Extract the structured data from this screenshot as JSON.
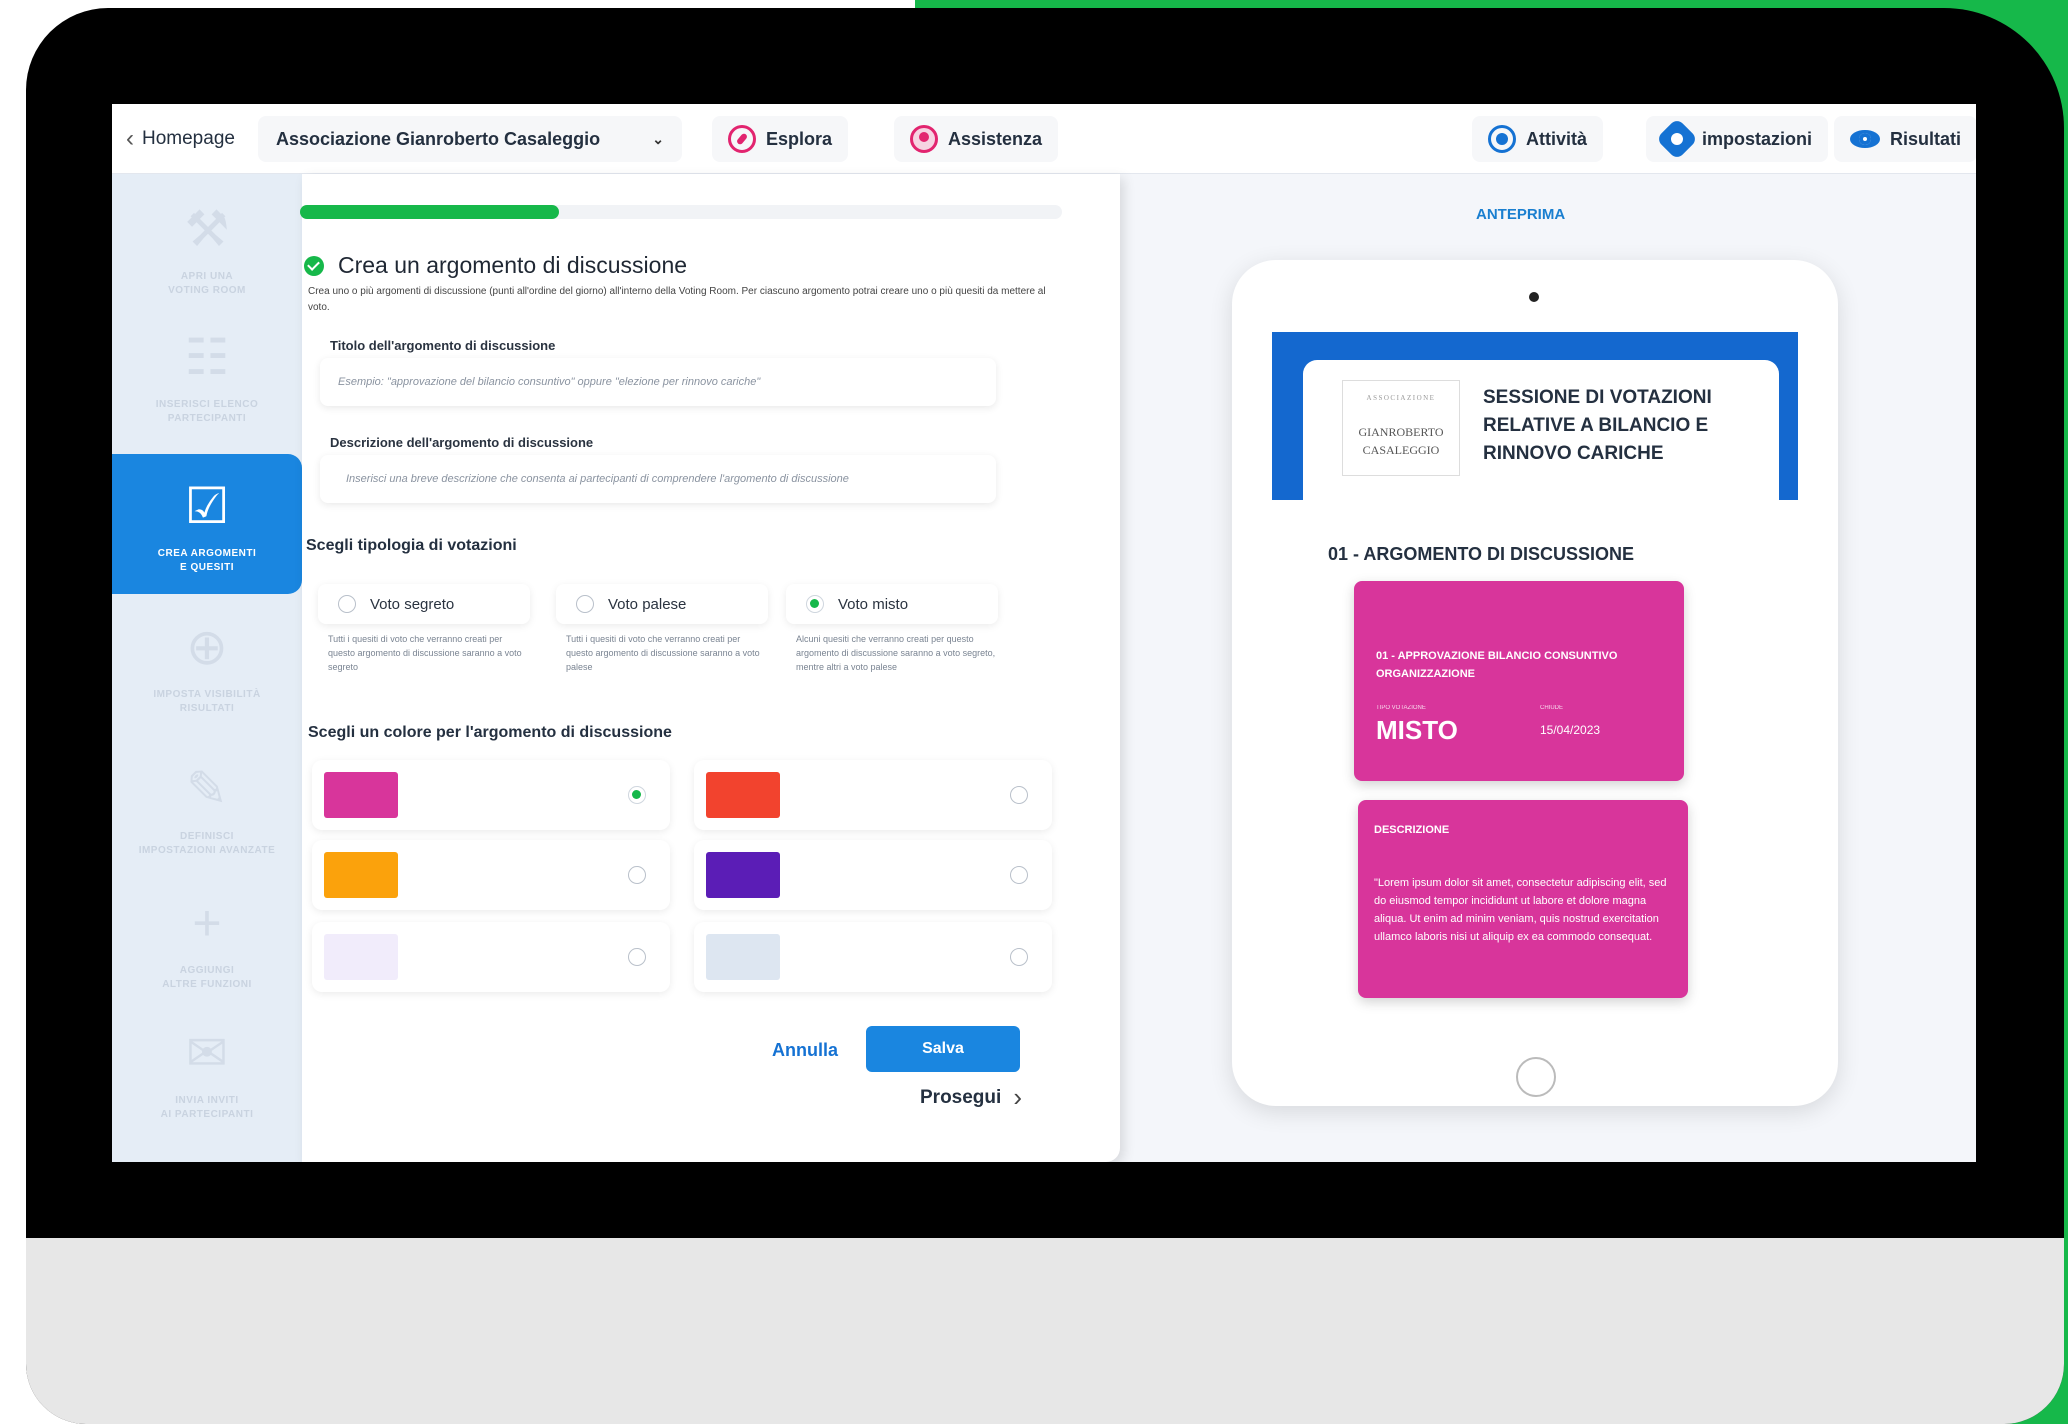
{
  "topbar": {
    "home_label": "Homepage",
    "org_label": "Associazione Gianroberto Casaleggio",
    "explore_label": "Esplora",
    "support_label": "Assistenza",
    "activity_label": "Attività",
    "settings_label": "impostazioni",
    "results_label": "Risultati"
  },
  "sidebar": {
    "items": [
      {
        "label": "APRI UNA\nVOTING ROOM",
        "icon": "compass-tools-icon"
      },
      {
        "label": "INSERISCI ELENCO\nPARTECIPANTI",
        "icon": "users-icon"
      },
      {
        "label": "CREA ARGOMENTI\nE QUESITI",
        "icon": "checkbox-icon",
        "active": true
      },
      {
        "label": "IMPOSTA VISIBILITÀ\nRISULTATI",
        "icon": "chart-search-icon"
      },
      {
        "label": "DEFINISCI\nIMPOSTAZIONI AVANZATE",
        "icon": "edit-icon"
      },
      {
        "label": "AGGIUNGI\nALTRE FUNZIONI",
        "icon": "plus-icon"
      },
      {
        "label": "INVIA INVITI\nAI PARTECIPANTI",
        "icon": "mail-icon"
      }
    ]
  },
  "form": {
    "progress_fraction": 0.34,
    "title": "Crea un argomento di discussione",
    "description": "Crea uno o più argomenti di discussione (punti all'ordine del giorno) all'interno della Voting Room. Per ciascuno argomento potrai creare uno o più quesiti da mettere al voto.",
    "topic_title_label": "Titolo dell'argomento di discussione",
    "topic_title_placeholder": "Esempio: \"approvazione del bilancio consuntivo\" oppure \"elezione per rinnovo cariche\"",
    "topic_desc_label": "Descrizione dell'argomento di discussione",
    "topic_desc_placeholder": "Inserisci una breve descrizione che consenta ai partecipanti di comprendere l'argomento di discussione",
    "vote_type_heading": "Scegli tipologia di votazioni",
    "vote_types": [
      {
        "label": "Voto segreto",
        "desc": "Tutti i quesiti di voto che verranno creati per questo argomento di discussione saranno a voto segreto",
        "selected": false
      },
      {
        "label": "Voto palese",
        "desc": "Tutti i quesiti di voto che verranno creati per questo argomento di discussione saranno a voto palese",
        "selected": false
      },
      {
        "label": "Voto misto",
        "desc": "Alcuni quesiti che verranno creati per questo argomento di discussione saranno a voto segreto, mentre altri a voto palese",
        "selected": true
      }
    ],
    "color_heading": "Scegli un colore per l'argomento di discussione",
    "colors": [
      "#d8359b",
      "#f2432e",
      "#fba20c",
      "#5b1db6",
      "#f1ecfb",
      "#dde6f1"
    ],
    "selected_color_index": 0,
    "cancel_label": "Annulla",
    "save_label": "Salva",
    "next_label": "Prosegui"
  },
  "preview": {
    "heading": "ANTEPRIMA",
    "logo_top": "ASSOCIAZIONE",
    "logo_name": "GIANROBERTO CASALEGGIO",
    "session_title": "SESSIONE DI VOTAZIONI RELATIVE A BILANCIO E RINNOVO CARICHE",
    "topic_title": "01 - ARGOMENTO DI DISCUSSIONE",
    "card1": {
      "title": "01 - APPROVAZIONE BILANCIO CONSUNTIVO ORGANIZZAZIONE",
      "type_key": "TIPO VOTAZIONE",
      "type_value": "MISTO",
      "close_key": "CHIUDE",
      "close_value": "15/04/2023"
    },
    "card2": {
      "title": "DESCRIZIONE",
      "text": "\"Lorem ipsum dolor sit amet, consectetur adipiscing elit, sed do eiusmod tempor incididunt ut labore et dolore magna aliqua. Ut enim ad minim veniam, quis nostrud exercitation ullamco laboris nisi ut aliquip ex ea commodo consequat."
    }
  }
}
